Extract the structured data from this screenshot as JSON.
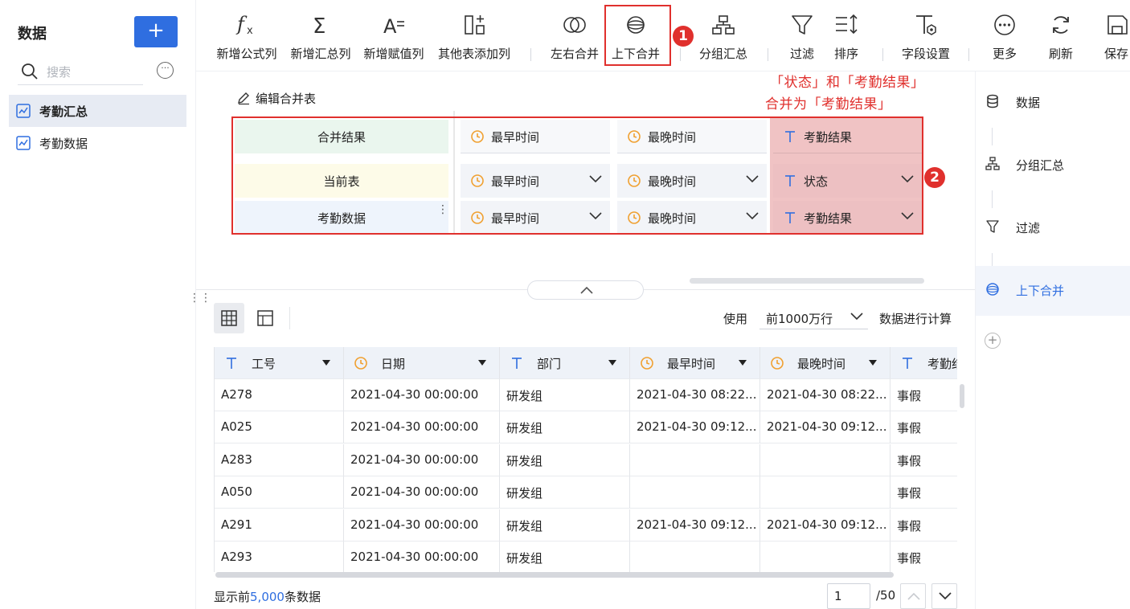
{
  "sidebar": {
    "title": "数据",
    "add_label": "+",
    "search_placeholder": "搜索",
    "more_label": "···",
    "items": [
      {
        "label": "考勤汇总",
        "active": true
      },
      {
        "label": "考勤数据",
        "active": false
      }
    ]
  },
  "toolbar": {
    "buttons": [
      {
        "label": "新增公式列",
        "icon": "formula-icon"
      },
      {
        "label": "新增汇总列",
        "icon": "sigma-icon"
      },
      {
        "label": "新增赋值列",
        "icon": "assign-icon"
      },
      {
        "label": "其他表添加列",
        "icon": "add-column-icon"
      },
      {
        "label": "左右合并",
        "icon": "join-icon"
      },
      {
        "label": "上下合并",
        "icon": "union-icon"
      },
      {
        "label": "分组汇总",
        "icon": "group-icon"
      },
      {
        "label": "过滤",
        "icon": "filter-icon"
      },
      {
        "label": "排序",
        "icon": "sort-icon"
      },
      {
        "label": "字段设置",
        "icon": "field-settings-icon"
      },
      {
        "label": "更多",
        "icon": "more-icon"
      },
      {
        "label": "刷新",
        "icon": "refresh-icon"
      },
      {
        "label": "保存",
        "icon": "save-icon"
      }
    ]
  },
  "annotations": {
    "badge1": "1",
    "badge2": "2",
    "note_line1": "「状态」和「考勤结果」",
    "note_line2": "合并为「考勤结果」"
  },
  "merge_editor": {
    "edit_label": "编辑合并表",
    "rows": [
      {
        "label": "合并结果",
        "fields": [
          "最早时间",
          "最晚时间",
          "考勤结果"
        ],
        "types": [
          "date",
          "date",
          "text"
        ]
      },
      {
        "label": "当前表",
        "fields": [
          "最早时间",
          "最晚时间",
          "状态"
        ],
        "types": [
          "date",
          "date",
          "text"
        ]
      },
      {
        "label": "考勤数据",
        "fields": [
          "最早时间",
          "最晚时间",
          "考勤结果"
        ],
        "types": [
          "date",
          "date",
          "text"
        ]
      }
    ]
  },
  "right_panel": {
    "steps": [
      {
        "label": "数据",
        "icon": "database-icon"
      },
      {
        "label": "分组汇总",
        "icon": "group-icon"
      },
      {
        "label": "过滤",
        "icon": "filter-icon"
      },
      {
        "label": "上下合并",
        "icon": "union-icon",
        "active": true
      }
    ],
    "add_label": "+"
  },
  "preview": {
    "use_label": "使用",
    "rows_option": "前1000万行",
    "calc_label": "数据进行计算",
    "columns": [
      {
        "label": "工号",
        "type": "text"
      },
      {
        "label": "日期",
        "type": "date"
      },
      {
        "label": "部门",
        "type": "text"
      },
      {
        "label": "最早时间",
        "type": "date"
      },
      {
        "label": "最晚时间",
        "type": "date"
      },
      {
        "label": "考勤结",
        "type": "text"
      }
    ],
    "rows": [
      [
        "A278",
        "2021-04-30 00:00:00",
        "研发组",
        "2021-04-30 08:22...",
        "2021-04-30 08:22...",
        "事假"
      ],
      [
        "A025",
        "2021-04-30 00:00:00",
        "研发组",
        "2021-04-30 09:12...",
        "2021-04-30 09:12...",
        "事假"
      ],
      [
        "A283",
        "2021-04-30 00:00:00",
        "研发组",
        "",
        "",
        "事假"
      ],
      [
        "A050",
        "2021-04-30 00:00:00",
        "研发组",
        "",
        "",
        "事假"
      ],
      [
        "A291",
        "2021-04-30 00:00:00",
        "研发组",
        "2021-04-30 09:12...",
        "2021-04-30 09:12...",
        "事假"
      ],
      [
        "A293",
        "2021-04-30 00:00:00",
        "研发组",
        "",
        "",
        "事假"
      ]
    ],
    "footer_prefix": "显示前",
    "footer_count": "5,000",
    "footer_suffix": "条数据",
    "page_value": "1",
    "page_total": "/50"
  },
  "colors": {
    "accent": "#2f6ee0",
    "highlight_red": "#e0302d",
    "date_icon": "#f0a030",
    "text_icon": "#2f6ee0"
  }
}
